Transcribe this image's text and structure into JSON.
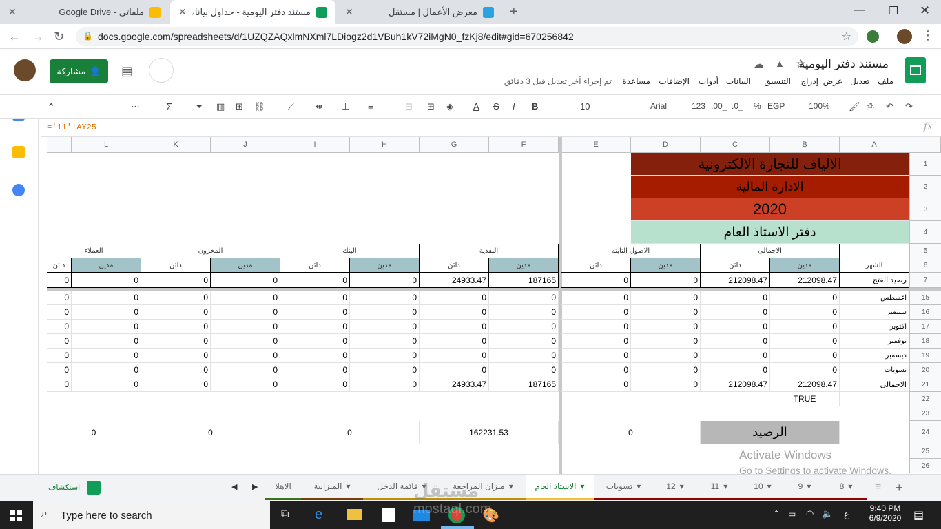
{
  "browser": {
    "tabs": [
      {
        "title": "ملفاتي - Google Drive",
        "favicon_color": "#fbbc04"
      },
      {
        "title": "مستند دفتر اليومية - جداول بيانات",
        "favicon_color": "#0f9d58"
      },
      {
        "title": "معرض الأعمال | مستقل",
        "favicon_color": "#2aa3e0"
      }
    ],
    "new_tab": "+",
    "url": "docs.google.com/spreadsheets/d/1UZQZAQxlmNXml7LDiogz2d1VBuh1kV72iMgN0_fzKj8/edit#gid=670256842"
  },
  "doc": {
    "title": "مستند دفتر اليومية",
    "menus": [
      "ملف",
      "تعديل",
      "عرض",
      "إدراج",
      "التنسيق",
      "البيانات",
      "أدوات",
      "الإضافات",
      "مساعدة"
    ],
    "last_edit": "تم إجراء آخر تعديل قبل 3 دقائق",
    "share_label": "مشاركة"
  },
  "toolbar": {
    "zoom": "100%",
    "currency": "EGP",
    "percent": "%",
    "dec_less": ".0_",
    "dec_more": ".00_",
    "number_format": "123",
    "font": "Arial",
    "font_size": "10",
    "more": "⋯"
  },
  "formula": {
    "text": "='11'!AY25",
    "fx": "fx"
  },
  "columns": [
    "A",
    "B",
    "C",
    "D",
    "E",
    "F",
    "G",
    "H",
    "I",
    "J",
    "K",
    "L"
  ],
  "rows": [
    "1",
    "2",
    "3",
    "4",
    "5",
    "6",
    "7",
    "15",
    "16",
    "17",
    "18",
    "19",
    "20",
    "21",
    "22",
    "23",
    "24",
    "25",
    "26"
  ],
  "sheet": {
    "banner1": "الالياف للتجارة الالكترونية",
    "banner2": "الادارة المالية",
    "banner3": "2020",
    "banner4": "دفتر الاستاذ العام",
    "month_header": "الشهر",
    "groups": [
      "الاجمالى",
      "الاصول الثابته",
      "النقدية",
      "البنك",
      "المخزون",
      "العملاء"
    ],
    "debit": "مدين",
    "credit": "دائن",
    "opening_label": "رصيد الفتح",
    "opening": [
      "212098.47",
      "212098.47",
      "0",
      "0",
      "187165",
      "24933.47",
      "0",
      "0",
      "0",
      "0",
      "0",
      "0"
    ],
    "months": [
      "اغسطس",
      "سبتمبر",
      "اكتوبر",
      "نوفمبر",
      "ديسمبر",
      "تسويات"
    ],
    "zero": "0",
    "total_label": "الاجمالى",
    "totals": [
      "212098.47",
      "212098.47",
      "0",
      "0",
      "187165",
      "24933.47",
      "0",
      "0",
      "0",
      "0",
      "0",
      "0"
    ],
    "check": "TRUE",
    "balance_label": "الرصيد",
    "balances": [
      "0",
      "162231.53",
      "0",
      "0",
      "0"
    ]
  },
  "sheet_tabs": [
    "8",
    "9",
    "10",
    "11",
    "12",
    "تسويات",
    "الاستاذ العام",
    "ميزان المراجعة",
    "قائمة الدخل",
    "الميزانية",
    "الاهلا"
  ],
  "explore": "استكشاف",
  "watermark": {
    "line1": "Activate Windows",
    "line2": "Go to Settings to activate Windows.",
    "brand": "mostaql.com"
  },
  "taskbar": {
    "search": "Type here to search",
    "time": "9:40 PM",
    "date": "6/9/2020",
    "lang": "ع"
  }
}
